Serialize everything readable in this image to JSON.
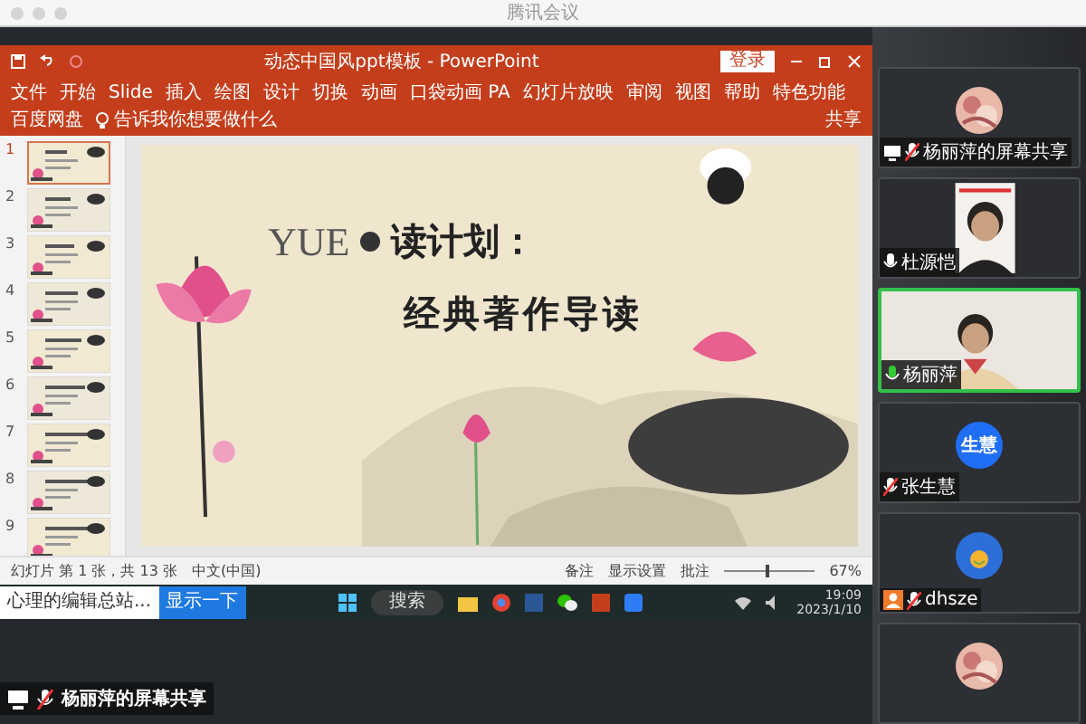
{
  "window": {
    "title": "腾讯会议"
  },
  "powerpoint": {
    "document_title": "动态中国风ppt模板 - PowerPoint",
    "login_button": "登录",
    "tabs": [
      {
        "label": "文件",
        "selected": false
      },
      {
        "label": "开始",
        "selected": false
      },
      {
        "label": "Slide",
        "selected": false
      },
      {
        "label": "插入",
        "selected": false
      },
      {
        "label": "绘图",
        "selected": false
      },
      {
        "label": "设计",
        "selected": false
      },
      {
        "label": "切换",
        "selected": false
      },
      {
        "label": "动画",
        "selected": false
      },
      {
        "label": "口袋动画 PA",
        "selected": false
      },
      {
        "label": "幻灯片放映",
        "selected": false
      },
      {
        "label": "审阅",
        "selected": false
      },
      {
        "label": "视图",
        "selected": false
      },
      {
        "label": "帮助",
        "selected": false
      },
      {
        "label": "特色功能",
        "selected": false
      },
      {
        "label": "百度网盘",
        "selected": false
      }
    ],
    "tell_me": "告诉我你想要做什么",
    "share_button": "共享",
    "thumbnails": [
      {
        "number": "1",
        "selected": true
      },
      {
        "number": "2",
        "selected": false
      },
      {
        "number": "3",
        "selected": false
      },
      {
        "number": "4",
        "selected": false
      },
      {
        "number": "5",
        "selected": false
      },
      {
        "number": "6",
        "selected": false
      },
      {
        "number": "7",
        "selected": false
      },
      {
        "number": "8",
        "selected": false
      },
      {
        "number": "9",
        "selected": false
      }
    ],
    "slide": {
      "title_latin": "YUE",
      "title_cjk": "读计划：",
      "subtitle": "经典著作导读"
    },
    "status_bar": {
      "slide_count": "幻灯片 第 1 张，共 13 张",
      "language": "中文(中国)",
      "notes": "备注",
      "display_settings": "显示设置",
      "comments": "批注",
      "zoom": "67%",
      "zoom_slider": {
        "level": 0.45
      }
    }
  },
  "taskbar": {
    "window_button": "心理的编辑总站...",
    "action_button": "显示一下",
    "search": "搜索",
    "time": "19:09",
    "date": "2023/1/10"
  },
  "participants": [
    {
      "name": "杨丽萍的屏幕共享",
      "kind": "avatar",
      "muted": true,
      "screen_share": true,
      "speaking": false,
      "host": false
    },
    {
      "name": "杜源恺",
      "kind": "video",
      "muted": false,
      "screen_share": false,
      "speaking": false,
      "host": false
    },
    {
      "name": "杨丽萍",
      "kind": "video",
      "muted": false,
      "screen_share": false,
      "speaking": true,
      "host": false
    },
    {
      "name": "张生慧",
      "kind": "initials",
      "initials": "生慧",
      "muted": true,
      "screen_share": false,
      "speaking": false,
      "host": false
    },
    {
      "name": "dhsze",
      "kind": "emoji",
      "muted": true,
      "screen_share": false,
      "speaking": false,
      "host": true
    },
    {
      "kind": "avatar"
    }
  ],
  "share_label": {
    "name": "杨丽萍的屏幕共享",
    "muted": true,
    "screen_share": true
  }
}
